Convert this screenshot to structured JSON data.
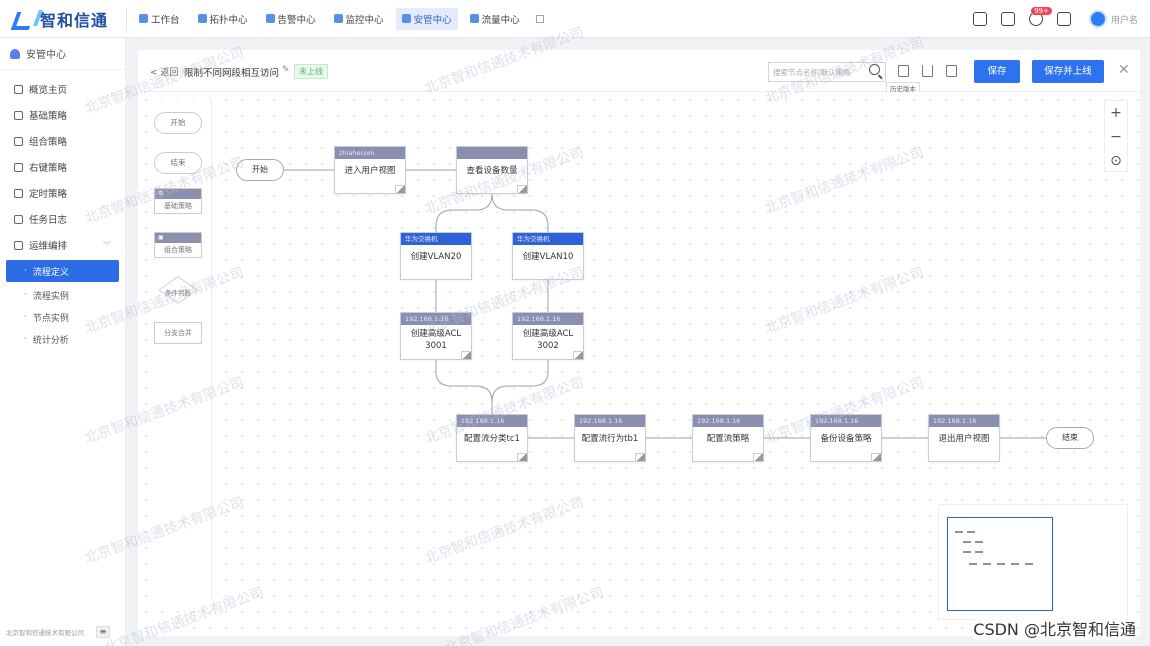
{
  "app": {
    "logo_text": "智和信通",
    "nav": [
      {
        "label": "工作台",
        "active": false
      },
      {
        "label": "拓扑中心",
        "active": false
      },
      {
        "label": "告警中心",
        "active": false
      },
      {
        "label": "监控中心",
        "active": false
      },
      {
        "label": "安管中心",
        "active": true
      },
      {
        "label": "流量中心",
        "active": false
      }
    ],
    "notify_badge": "99+",
    "username": "用户名"
  },
  "sidebar": {
    "title": "安管中心",
    "items": [
      {
        "label": "概览主页"
      },
      {
        "label": "基础策略"
      },
      {
        "label": "组合策略"
      },
      {
        "label": "右键策略"
      },
      {
        "label": "定时策略"
      },
      {
        "label": "任务日志"
      },
      {
        "label": "运维编排"
      }
    ],
    "sub_items": [
      {
        "label": "流程定义",
        "active": true
      },
      {
        "label": "流程实例",
        "active": false
      },
      {
        "label": "节点实例",
        "active": false
      },
      {
        "label": "统计分析",
        "active": false
      }
    ],
    "footer": "北京智和信通技术有限公司"
  },
  "toolbar": {
    "back_label": "< 返回",
    "flow_title": "限制不同网段相互访问",
    "status_tag": "未上线",
    "search_placeholder": "搜索节点名称/默认策略",
    "tooltip": "历史版本",
    "save_label": "保存",
    "save_publish_label": "保存并上线"
  },
  "palette": {
    "start": "开始",
    "end": "结束",
    "basic": "基础策略",
    "combo": "组合策略",
    "cond": "条件判断",
    "branch": "分支合并"
  },
  "flow": {
    "start": "开始",
    "end": "结束",
    "nodes": [
      {
        "id": "n1",
        "header": "zhiahecom",
        "label": "进入用户视图",
        "blue": false
      },
      {
        "id": "n2",
        "header": "",
        "label": "查看设备数量",
        "blue": false
      },
      {
        "id": "n3",
        "header": "华为交换机",
        "label": "创建VLAN20",
        "blue": true
      },
      {
        "id": "n4",
        "header": "华为交换机",
        "label": "创建VLAN10",
        "blue": true
      },
      {
        "id": "n5",
        "header": "192.168.1.16",
        "label": "创建高级ACL 3001",
        "blue": false
      },
      {
        "id": "n6",
        "header": "192.168.1.16",
        "label": "创建高级ACL 3002",
        "blue": false
      },
      {
        "id": "n7",
        "header": "192.168.1.16",
        "label": "配置流分类tc1",
        "blue": false
      },
      {
        "id": "n8",
        "header": "192.168.1.16",
        "label": "配置流行为tb1",
        "blue": false
      },
      {
        "id": "n9",
        "header": "192.168.1.16",
        "label": "配置流策略",
        "blue": false
      },
      {
        "id": "n10",
        "header": "192.168.1.16",
        "label": "备份设备策略",
        "blue": false
      },
      {
        "id": "n11",
        "header": "192.168.1.16",
        "label": "退出用户视图",
        "blue": false
      }
    ]
  },
  "watermark": "北京智和信通技术有限公司",
  "csdn": "CSDN @北京智和信通",
  "colors": {
    "accent": "#2e72f0",
    "node_header": "#8a8fb0",
    "node_header_blue": "#2f62d6"
  }
}
